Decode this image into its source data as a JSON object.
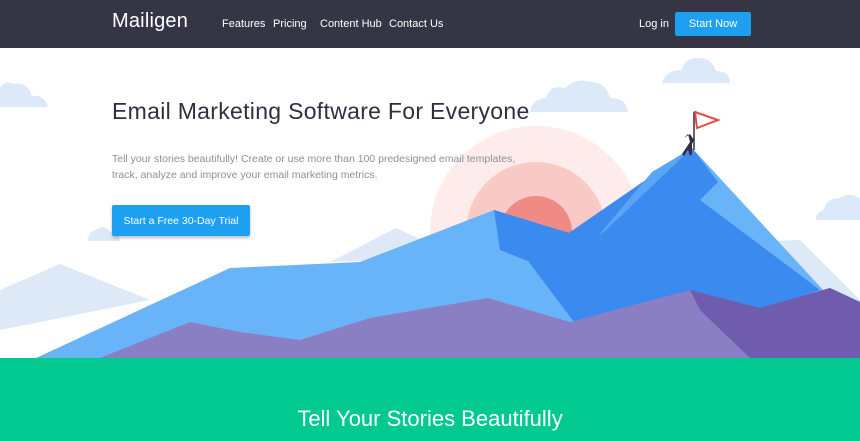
{
  "header": {
    "logo": "Mailigen",
    "menu": [
      "Features",
      "Pricing",
      "Content Hub",
      "Contact Us"
    ],
    "login": "Log in",
    "start_now": "Start Now"
  },
  "hero": {
    "title": "Email Marketing Software For Everyone",
    "description": "Tell your stories beautifully! Create or use more than 100 predesigned email templates, track, analyze and improve your email marketing metrics.",
    "cta": "Start a Free 30-Day Trial"
  },
  "section": {
    "title": "Tell Your Stories Beautifully"
  },
  "colors": {
    "nav_bg": "#363546",
    "accent": "#1ea0f2",
    "green": "#02c990",
    "sun": "#f08a84",
    "mountain_blue": "#3a8af0",
    "mountain_light": "#69b4f8",
    "mountain_purple": "#8b7fc4",
    "cloud": "#dbe9f8"
  },
  "icons": [
    "logo-mark",
    "flag-icon",
    "climber-figure"
  ]
}
